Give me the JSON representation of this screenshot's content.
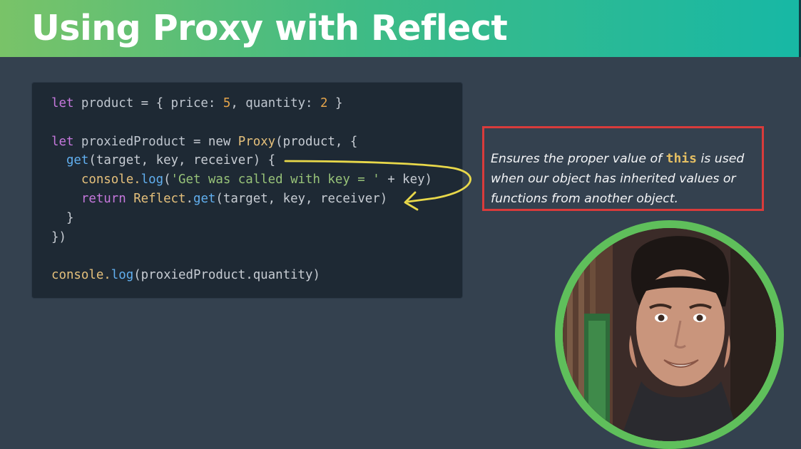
{
  "slide": {
    "title": "Using Proxy with Reflect"
  },
  "code": {
    "lines": [
      [
        {
          "t": "let ",
          "c": "kw"
        },
        {
          "t": "product ",
          "c": "var"
        },
        {
          "t": "= { ",
          "c": "pun"
        },
        {
          "t": "price: ",
          "c": "prop"
        },
        {
          "t": "5",
          "c": "num"
        },
        {
          "t": ", ",
          "c": "pun"
        },
        {
          "t": "quantity: ",
          "c": "prop"
        },
        {
          "t": "2",
          "c": "num"
        },
        {
          "t": " }",
          "c": "pun"
        }
      ],
      [],
      [
        {
          "t": "let ",
          "c": "kw"
        },
        {
          "t": "proxiedProduct ",
          "c": "var"
        },
        {
          "t": "= new ",
          "c": "pun"
        },
        {
          "t": "Proxy",
          "c": "cls"
        },
        {
          "t": "(product, {",
          "c": "pun"
        }
      ],
      [
        {
          "t": "  ",
          "c": "pun"
        },
        {
          "t": "get",
          "c": "fn"
        },
        {
          "t": "(target, key, receiver) {",
          "c": "pun"
        }
      ],
      [
        {
          "t": "    console.",
          "c": "cls"
        },
        {
          "t": "log",
          "c": "fn"
        },
        {
          "t": "(",
          "c": "pun"
        },
        {
          "t": "'Get was called with key = '",
          "c": "str"
        },
        {
          "t": " + key)",
          "c": "pun"
        }
      ],
      [
        {
          "t": "    ",
          "c": "pun"
        },
        {
          "t": "return ",
          "c": "kw"
        },
        {
          "t": "Reflect",
          "c": "cls"
        },
        {
          "t": ".",
          "c": "pun"
        },
        {
          "t": "get",
          "c": "fn"
        },
        {
          "t": "(target, key, receiver)",
          "c": "pun"
        }
      ],
      [
        {
          "t": "  }",
          "c": "pun"
        }
      ],
      [
        {
          "t": "})",
          "c": "pun"
        }
      ],
      [],
      [
        {
          "t": "console.",
          "c": "cls"
        },
        {
          "t": "log",
          "c": "fn"
        },
        {
          "t": "(proxiedProduct.quantity)",
          "c": "pun"
        }
      ]
    ]
  },
  "callout": {
    "text_before": "Ensures the proper value of ",
    "keyword": "this",
    "text_after": " is used when our object has inherited values or functions from another object.",
    "border_color": "#d93b3b",
    "keyword_color": "#e5bf63"
  },
  "annotation": {
    "arrow_color": "#e8d84a",
    "arrow_icon": "hand-drawn-curved-arrow"
  },
  "presenter": {
    "ring_color": "#5fbf5b",
    "video_icon": "presenter-video"
  },
  "colors": {
    "title_gradient_start": "#79c368",
    "title_gradient_end": "#17b8a5",
    "background": "#34414f",
    "code_background": "#1e2934"
  }
}
